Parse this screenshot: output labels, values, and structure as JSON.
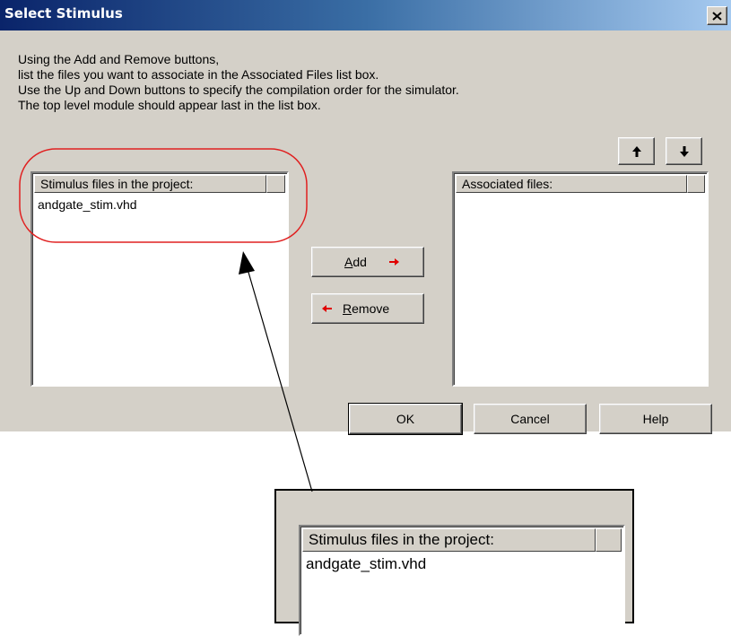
{
  "dialog": {
    "title": "Select Stimulus",
    "instructions": [
      "Using the Add and Remove buttons,",
      "list the files you want to associate in the Associated Files list box.",
      "Use the Up and Down buttons to specify the compilation order for the simulator.",
      "The top level module should appear last in the list box."
    ],
    "stimulus_list": {
      "header": "Stimulus files in the project:",
      "items": [
        "andgate_stim.vhd"
      ]
    },
    "associated_list": {
      "header": "Associated files:",
      "items": []
    },
    "buttons": {
      "add": "Add",
      "remove": "Remove",
      "ok": "OK",
      "cancel": "Cancel",
      "help": "Help"
    }
  },
  "callout": {
    "header": "Stimulus files in the project:",
    "item": "andgate_stim.vhd"
  },
  "colors": {
    "dialog_bg": "#d4d0c8",
    "title_start": "#0a246a",
    "title_end": "#a6caf0",
    "highlight_ring": "#e02020",
    "arrow_red": "#e00000"
  }
}
